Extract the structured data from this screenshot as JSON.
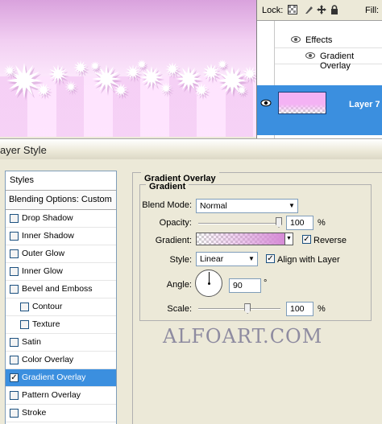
{
  "layers_panel": {
    "lock_label": "Lock:",
    "fill_label": "Fill:",
    "lock_icons": [
      "lock-transparent-icon",
      "lock-image-icon",
      "lock-position-icon",
      "lock-all-icon"
    ],
    "effects_label": "Effects",
    "effect_item": "Gradient Overlay",
    "layer_name": "Layer 7",
    "selection_color": "#3b8fdf"
  },
  "dialog": {
    "title": "ayer Style",
    "styles_header": "Styles",
    "blending_options": "Blending Options: Custom",
    "style_items": [
      {
        "label": "Drop Shadow",
        "checked": false,
        "indent": false
      },
      {
        "label": "Inner Shadow",
        "checked": false,
        "indent": false
      },
      {
        "label": "Outer Glow",
        "checked": false,
        "indent": false
      },
      {
        "label": "Inner Glow",
        "checked": false,
        "indent": false
      },
      {
        "label": "Bevel and Emboss",
        "checked": false,
        "indent": false
      },
      {
        "label": "Contour",
        "checked": false,
        "indent": true
      },
      {
        "label": "Texture",
        "checked": false,
        "indent": true
      },
      {
        "label": "Satin",
        "checked": false,
        "indent": false
      },
      {
        "label": "Color Overlay",
        "checked": false,
        "indent": false
      },
      {
        "label": "Gradient Overlay",
        "checked": true,
        "indent": false,
        "active": true
      },
      {
        "label": "Pattern Overlay",
        "checked": false,
        "indent": false
      },
      {
        "label": "Stroke",
        "checked": false,
        "indent": false
      }
    ]
  },
  "gradient_overlay": {
    "group_title": "Gradient Overlay",
    "sub_title": "Gradient",
    "blend_mode_label": "Blend Mode:",
    "blend_mode_value": "Normal",
    "opacity_label": "Opacity:",
    "opacity_value": "100",
    "opacity_unit": "%",
    "opacity_fraction": 1.0,
    "gradient_label": "Gradient:",
    "reverse_label": "Reverse",
    "reverse_checked": true,
    "style_label": "Style:",
    "style_value": "Linear",
    "align_label": "Align with Layer",
    "align_checked": true,
    "angle_label": "Angle:",
    "angle_value": "90",
    "angle_unit": "°",
    "scale_label": "Scale:",
    "scale_value": "100",
    "scale_unit": "%",
    "scale_fraction": 0.6,
    "gradient_color": "#d68bd6"
  },
  "watermark": "ALFOART.COM"
}
